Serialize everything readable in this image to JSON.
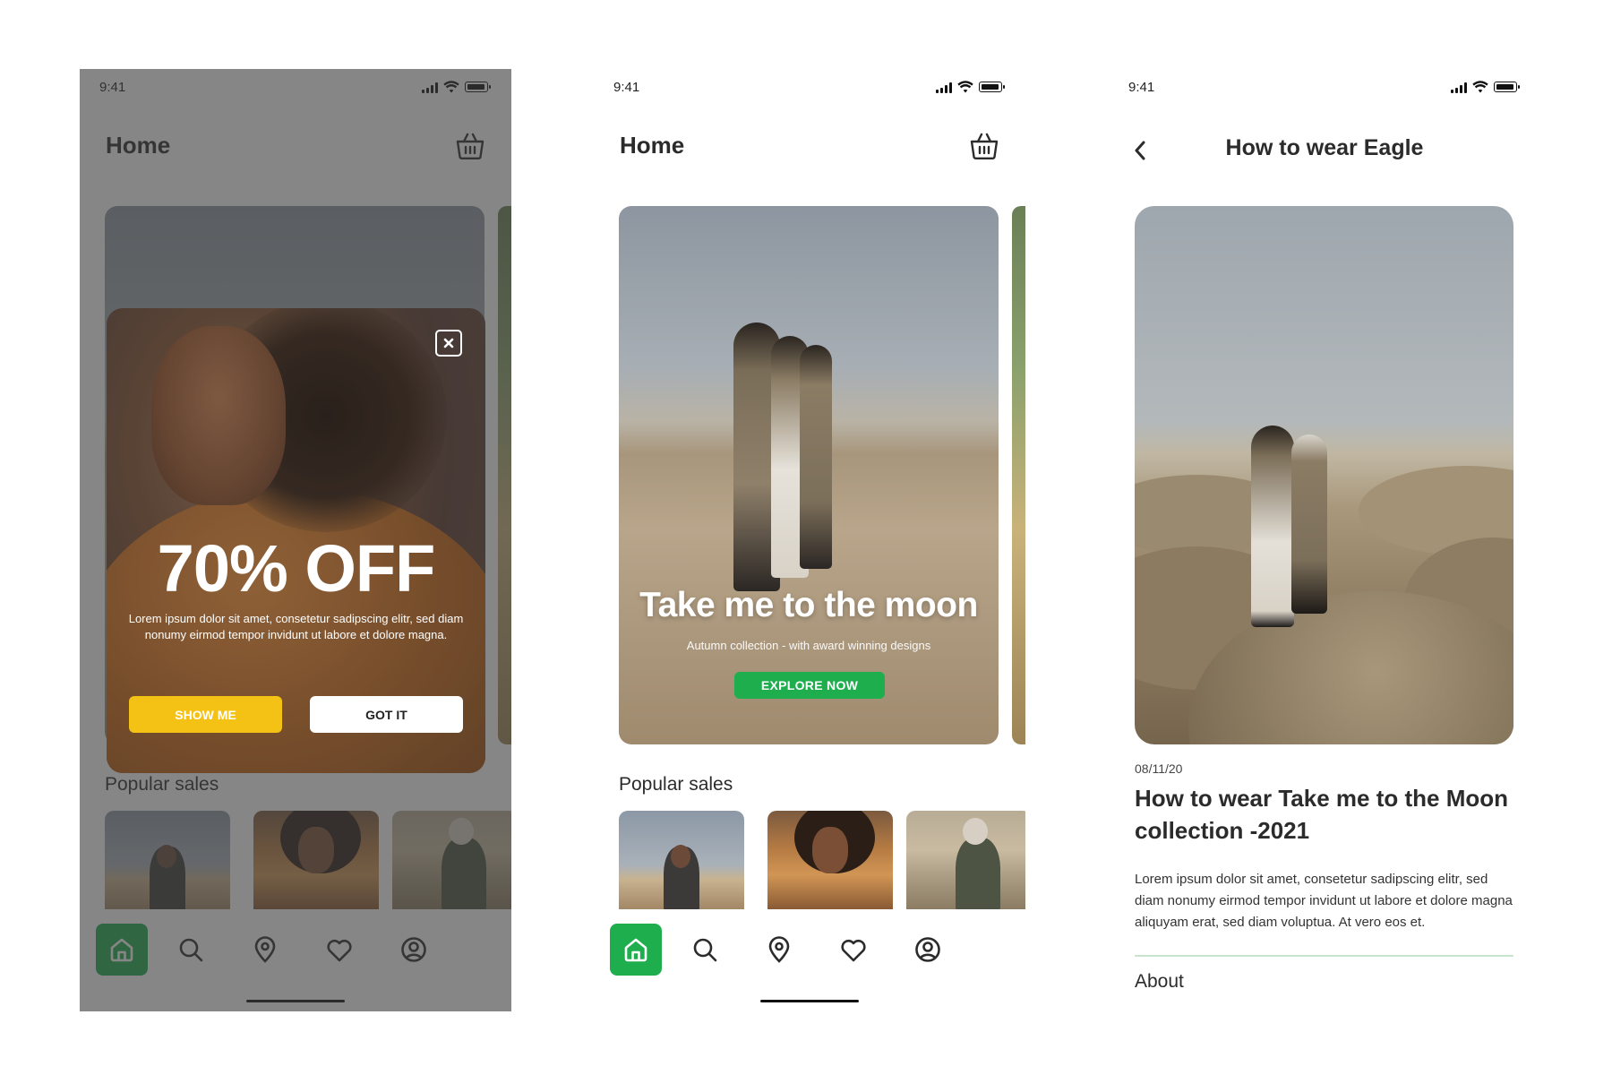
{
  "status": {
    "time": "9:41"
  },
  "home": {
    "title": "Home",
    "hero": {
      "title": "Take me to the moon",
      "subtitle": "Autumn collection - with award winning designs",
      "cta": "EXPLORE NOW"
    },
    "popular_title": "Popular sales",
    "popular_items": [
      "thumb-1",
      "thumb-2",
      "thumb-3"
    ]
  },
  "popup": {
    "title": "70% OFF",
    "text": "Lorem ipsum dolor sit amet, consetetur sadipscing elitr, sed diam nonumy eirmod tempor invidunt ut labore et dolore magna.",
    "primary": "SHOW ME",
    "secondary": "GOT IT"
  },
  "nav": {
    "items": [
      {
        "icon": "home-icon",
        "active": true
      },
      {
        "icon": "search-icon",
        "active": false
      },
      {
        "icon": "location-pin-icon",
        "active": false
      },
      {
        "icon": "heart-icon",
        "active": false
      },
      {
        "icon": "profile-icon",
        "active": false
      }
    ]
  },
  "detail": {
    "title": "How to wear Eagle",
    "date": "08/11/20",
    "article_title": "How to wear Take me to the Moon collection -2021",
    "body": "Lorem ipsum dolor sit amet, consetetur sadipscing elitr, sed diam nonumy eirmod tempor invidunt ut labore et dolore magna aliquyam erat, sed diam voluptua. At vero eos et.",
    "about": "About"
  },
  "colors": {
    "accent_green": "#1fae4e",
    "accent_yellow": "#f4c215",
    "text_dark": "#2b2b2b"
  }
}
